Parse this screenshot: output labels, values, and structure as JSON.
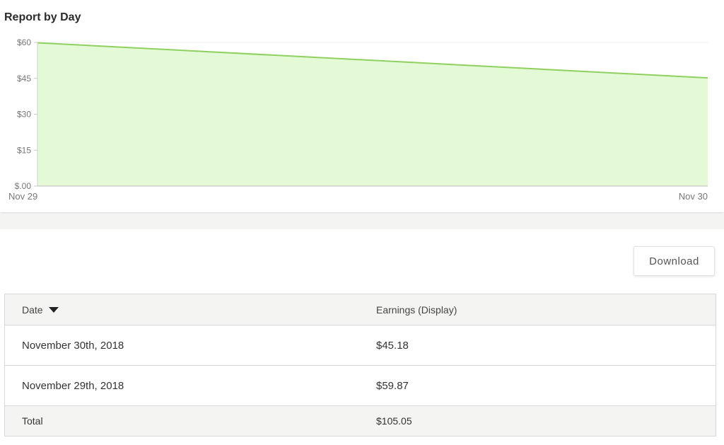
{
  "report": {
    "title": "Report by Day"
  },
  "chart_data": {
    "type": "area",
    "x": [
      "Nov 29",
      "Nov 30"
    ],
    "series": [
      {
        "values": [
          59.87,
          45.18
        ]
      }
    ],
    "y_ticks": [
      "$.00",
      "$15",
      "$30",
      "$45",
      "$60"
    ],
    "ylim": [
      0,
      60
    ],
    "grid": true,
    "line_color": "#8fd15f",
    "fill_color": "#e4f9d6"
  },
  "toolbar": {
    "download_label": "Download"
  },
  "table": {
    "headers": {
      "date": "Date",
      "earnings": "Earnings (Display)"
    },
    "rows": [
      {
        "date": "November 30th, 2018",
        "earnings": "$45.18"
      },
      {
        "date": "November 29th, 2018",
        "earnings": "$59.87"
      }
    ],
    "total": {
      "label": "Total",
      "earnings": "$105.05"
    }
  }
}
